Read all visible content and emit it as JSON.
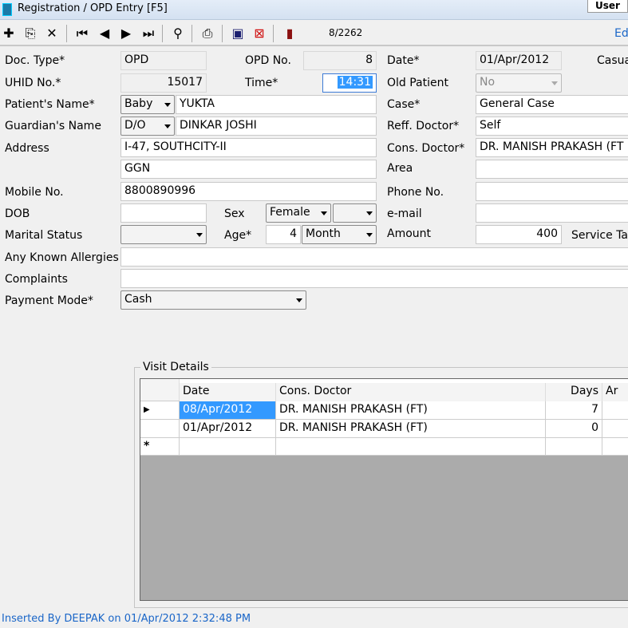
{
  "window": {
    "title": "Registration / OPD Entry [F5]",
    "user_tab": "User"
  },
  "toolbar": {
    "record_position": "8/2262",
    "edit_label": "Ed",
    "buttons": [
      "add-icon",
      "copy-icon",
      "delete-icon",
      "first-record-icon",
      "previous-record-icon",
      "next-record-icon",
      "last-record-icon",
      "find-binoculars-icon",
      "print-icon",
      "save-icon",
      "cancel-save-icon",
      "exit-icon"
    ]
  },
  "form": {
    "doc_type": {
      "label": "Doc. Type*",
      "value": "OPD"
    },
    "opd_no": {
      "label": "OPD No.",
      "value": "8"
    },
    "date": {
      "label": "Date*",
      "value": "01/Apr/2012"
    },
    "casualty": {
      "label": "Casua"
    },
    "uhid": {
      "label": "UHID No.*",
      "value": "15017"
    },
    "time": {
      "label": "Time*",
      "value": "14:31"
    },
    "old_patient": {
      "label": "Old Patient",
      "value": "No"
    },
    "patient_name": {
      "label": "Patient's Name*",
      "prefix": "Baby",
      "value": "YUKTA"
    },
    "case": {
      "label": "Case*",
      "value": "General Case"
    },
    "guardian": {
      "label": "Guardian's Name",
      "relation": "D/O",
      "value": "DINKAR JOSHI"
    },
    "reff_doctor": {
      "label": "Reff. Doctor*",
      "value": "Self"
    },
    "address": {
      "label": "Address",
      "line1": "I-47, SOUTHCITY-II",
      "line2": "GGN"
    },
    "cons_doctor": {
      "label": "Cons. Doctor*",
      "value": "DR. MANISH PRAKASH (FT"
    },
    "area": {
      "label": "Area",
      "value": ""
    },
    "mobile": {
      "label": "Mobile No.",
      "value": "8800890996"
    },
    "phone": {
      "label": "Phone No.",
      "value": ""
    },
    "dob": {
      "label": "DOB",
      "value": ""
    },
    "sex": {
      "label": "Sex",
      "value": "Female",
      "extra": ""
    },
    "email": {
      "label": "e-mail",
      "value": ""
    },
    "marital": {
      "label": "Marital Status",
      "value": ""
    },
    "age": {
      "label": "Age*",
      "value": "4",
      "unit": "Month"
    },
    "amount": {
      "label": "Amount",
      "value": "400"
    },
    "service_tax": {
      "label": "Service Ta"
    },
    "allergies": {
      "label": "Any Known Allergies",
      "value": ""
    },
    "complaints": {
      "label": "Complaints",
      "value": ""
    },
    "payment_mode": {
      "label": "Payment Mode*",
      "value": "Cash"
    }
  },
  "visits": {
    "title": "Visit Details",
    "columns": [
      "Date",
      "Cons. Doctor",
      "Days",
      "Ar"
    ],
    "rows": [
      {
        "date": "08/Apr/2012",
        "doctor": "DR. MANISH PRAKASH (FT)",
        "days": "7",
        "amount": ""
      },
      {
        "date": "01/Apr/2012",
        "doctor": "DR. MANISH PRAKASH (FT)",
        "days": "0",
        "amount": ""
      }
    ],
    "current_marker": "▶",
    "new_marker": "*"
  },
  "status": {
    "text": "Inserted By DEEPAK on 01/Apr/2012 2:32:48 PM"
  }
}
